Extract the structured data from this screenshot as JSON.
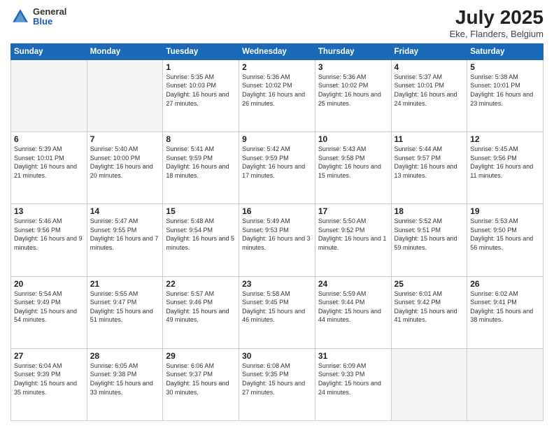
{
  "header": {
    "logo_general": "General",
    "logo_blue": "Blue",
    "title": "July 2025",
    "location": "Eke, Flanders, Belgium"
  },
  "weekdays": [
    "Sunday",
    "Monday",
    "Tuesday",
    "Wednesday",
    "Thursday",
    "Friday",
    "Saturday"
  ],
  "weeks": [
    [
      {
        "day": "",
        "info": ""
      },
      {
        "day": "",
        "info": ""
      },
      {
        "day": "1",
        "info": "Sunrise: 5:35 AM\nSunset: 10:03 PM\nDaylight: 16 hours\nand 27 minutes."
      },
      {
        "day": "2",
        "info": "Sunrise: 5:36 AM\nSunset: 10:02 PM\nDaylight: 16 hours\nand 26 minutes."
      },
      {
        "day": "3",
        "info": "Sunrise: 5:36 AM\nSunset: 10:02 PM\nDaylight: 16 hours\nand 25 minutes."
      },
      {
        "day": "4",
        "info": "Sunrise: 5:37 AM\nSunset: 10:01 PM\nDaylight: 16 hours\nand 24 minutes."
      },
      {
        "day": "5",
        "info": "Sunrise: 5:38 AM\nSunset: 10:01 PM\nDaylight: 16 hours\nand 23 minutes."
      }
    ],
    [
      {
        "day": "6",
        "info": "Sunrise: 5:39 AM\nSunset: 10:01 PM\nDaylight: 16 hours\nand 21 minutes."
      },
      {
        "day": "7",
        "info": "Sunrise: 5:40 AM\nSunset: 10:00 PM\nDaylight: 16 hours\nand 20 minutes."
      },
      {
        "day": "8",
        "info": "Sunrise: 5:41 AM\nSunset: 9:59 PM\nDaylight: 16 hours\nand 18 minutes."
      },
      {
        "day": "9",
        "info": "Sunrise: 5:42 AM\nSunset: 9:59 PM\nDaylight: 16 hours\nand 17 minutes."
      },
      {
        "day": "10",
        "info": "Sunrise: 5:43 AM\nSunset: 9:58 PM\nDaylight: 16 hours\nand 15 minutes."
      },
      {
        "day": "11",
        "info": "Sunrise: 5:44 AM\nSunset: 9:57 PM\nDaylight: 16 hours\nand 13 minutes."
      },
      {
        "day": "12",
        "info": "Sunrise: 5:45 AM\nSunset: 9:56 PM\nDaylight: 16 hours\nand 11 minutes."
      }
    ],
    [
      {
        "day": "13",
        "info": "Sunrise: 5:46 AM\nSunset: 9:56 PM\nDaylight: 16 hours\nand 9 minutes."
      },
      {
        "day": "14",
        "info": "Sunrise: 5:47 AM\nSunset: 9:55 PM\nDaylight: 16 hours\nand 7 minutes."
      },
      {
        "day": "15",
        "info": "Sunrise: 5:48 AM\nSunset: 9:54 PM\nDaylight: 16 hours\nand 5 minutes."
      },
      {
        "day": "16",
        "info": "Sunrise: 5:49 AM\nSunset: 9:53 PM\nDaylight: 16 hours\nand 3 minutes."
      },
      {
        "day": "17",
        "info": "Sunrise: 5:50 AM\nSunset: 9:52 PM\nDaylight: 16 hours\nand 1 minute."
      },
      {
        "day": "18",
        "info": "Sunrise: 5:52 AM\nSunset: 9:51 PM\nDaylight: 15 hours\nand 59 minutes."
      },
      {
        "day": "19",
        "info": "Sunrise: 5:53 AM\nSunset: 9:50 PM\nDaylight: 15 hours\nand 56 minutes."
      }
    ],
    [
      {
        "day": "20",
        "info": "Sunrise: 5:54 AM\nSunset: 9:49 PM\nDaylight: 15 hours\nand 54 minutes."
      },
      {
        "day": "21",
        "info": "Sunrise: 5:55 AM\nSunset: 9:47 PM\nDaylight: 15 hours\nand 51 minutes."
      },
      {
        "day": "22",
        "info": "Sunrise: 5:57 AM\nSunset: 9:46 PM\nDaylight: 15 hours\nand 49 minutes."
      },
      {
        "day": "23",
        "info": "Sunrise: 5:58 AM\nSunset: 9:45 PM\nDaylight: 15 hours\nand 46 minutes."
      },
      {
        "day": "24",
        "info": "Sunrise: 5:59 AM\nSunset: 9:44 PM\nDaylight: 15 hours\nand 44 minutes."
      },
      {
        "day": "25",
        "info": "Sunrise: 6:01 AM\nSunset: 9:42 PM\nDaylight: 15 hours\nand 41 minutes."
      },
      {
        "day": "26",
        "info": "Sunrise: 6:02 AM\nSunset: 9:41 PM\nDaylight: 15 hours\nand 38 minutes."
      }
    ],
    [
      {
        "day": "27",
        "info": "Sunrise: 6:04 AM\nSunset: 9:39 PM\nDaylight: 15 hours\nand 35 minutes."
      },
      {
        "day": "28",
        "info": "Sunrise: 6:05 AM\nSunset: 9:38 PM\nDaylight: 15 hours\nand 33 minutes."
      },
      {
        "day": "29",
        "info": "Sunrise: 6:06 AM\nSunset: 9:37 PM\nDaylight: 15 hours\nand 30 minutes."
      },
      {
        "day": "30",
        "info": "Sunrise: 6:08 AM\nSunset: 9:35 PM\nDaylight: 15 hours\nand 27 minutes."
      },
      {
        "day": "31",
        "info": "Sunrise: 6:09 AM\nSunset: 9:33 PM\nDaylight: 15 hours\nand 24 minutes."
      },
      {
        "day": "",
        "info": ""
      },
      {
        "day": "",
        "info": ""
      }
    ]
  ]
}
